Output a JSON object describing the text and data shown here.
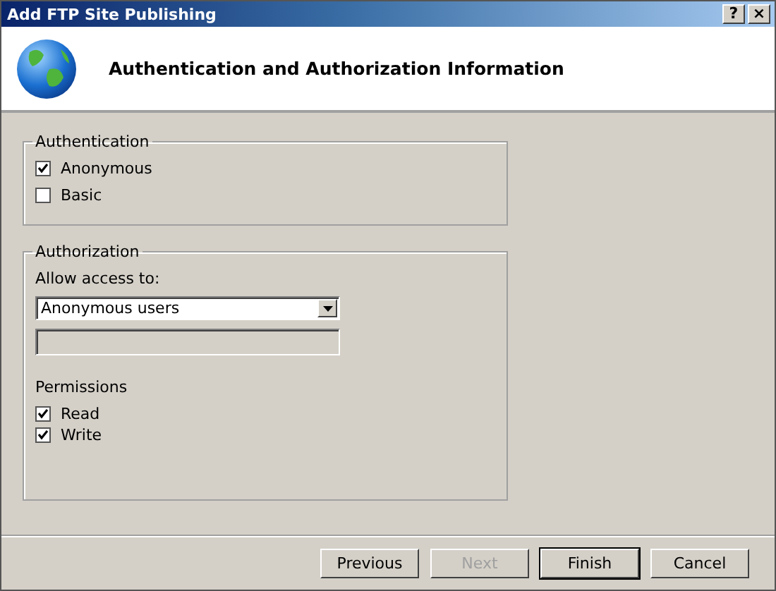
{
  "window": {
    "title": "Add FTP Site Publishing",
    "help_button": "?",
    "close_button": "×"
  },
  "header": {
    "title": "Authentication and Authorization Information"
  },
  "authentication": {
    "legend": "Authentication",
    "options": [
      {
        "label": "Anonymous",
        "checked": true
      },
      {
        "label": "Basic",
        "checked": false
      }
    ]
  },
  "authorization": {
    "legend": "Authorization",
    "access_label": "Allow access to:",
    "access_value": "Anonymous users",
    "users_field": {
      "disabled": true
    },
    "permissions_label": "Permissions",
    "permissions": [
      {
        "label": "Read",
        "checked": true
      },
      {
        "label": "Write",
        "checked": true
      }
    ]
  },
  "buttons": [
    {
      "label": "Previous",
      "disabled": false,
      "default": false
    },
    {
      "label": "Next",
      "disabled": true,
      "default": false
    },
    {
      "label": "Finish",
      "disabled": false,
      "default": true
    },
    {
      "label": "Cancel",
      "disabled": false,
      "default": false
    }
  ]
}
